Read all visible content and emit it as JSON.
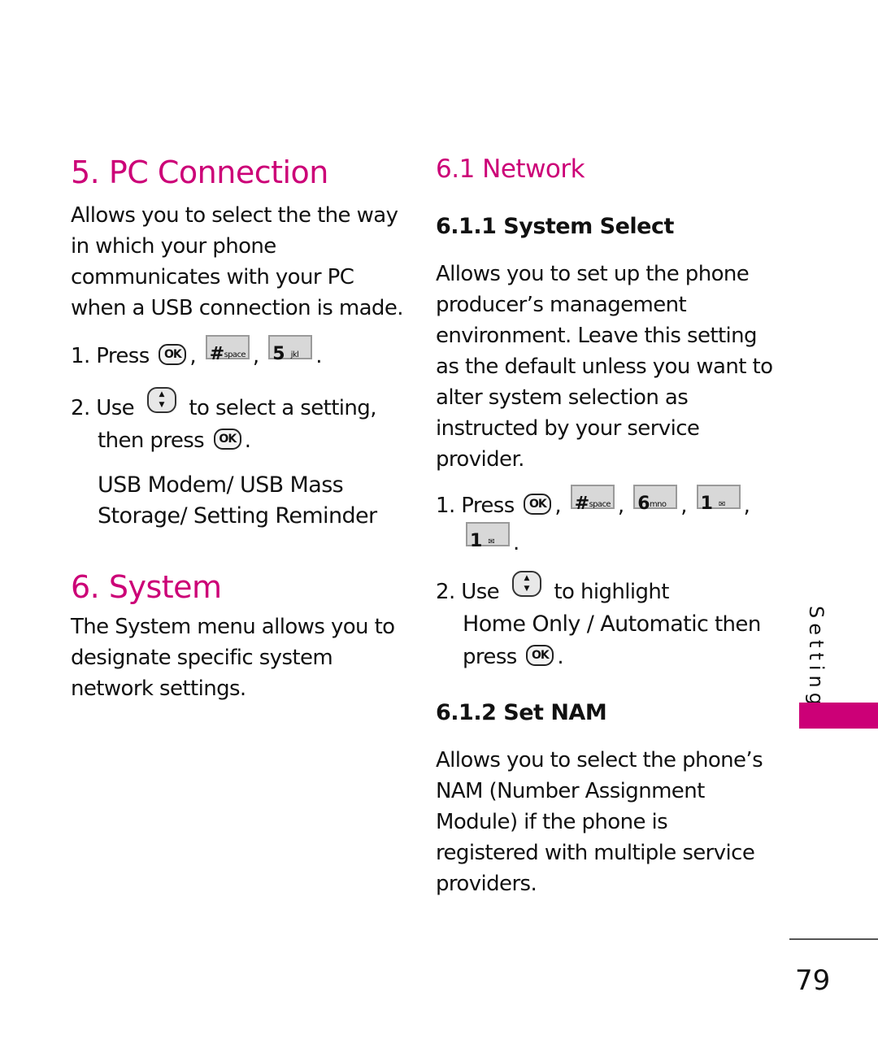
{
  "colors": {
    "accent": "#cc0077",
    "text": "#111111"
  },
  "left": {
    "pc_connection": {
      "title": "5. PC Connection",
      "description_lines": [
        "Allows you to select the the way",
        "in which your phone",
        "communicates with your PC",
        "when a USB connection is made."
      ],
      "step1": {
        "prefix": "1. Press",
        "keys": [
          "OK",
          "#",
          "5"
        ],
        "key_labels": {
          "hash_main": "#",
          "hash_sub": "space",
          "five_main": "5",
          "five_sub": "jkl"
        }
      },
      "step2": {
        "prefix": "2. Use",
        "middle": "to select a setting,",
        "line2": "then press",
        "end": "."
      },
      "options_lines": [
        "USB Modem/ USB Mass",
        "Storage/ Setting Reminder"
      ]
    },
    "system": {
      "title": "6. System",
      "description_lines": [
        "The System menu allows you to",
        "designate specific system",
        "network settings."
      ]
    }
  },
  "right": {
    "network": {
      "title": "6.1 Network"
    },
    "system_select": {
      "title": "6.1.1 System Select",
      "description_lines": [
        "Allows you to set up the phone",
        "producer’s management",
        "environment. Leave this setting",
        "as the default unless you want to",
        "alter system selection as",
        "instructed by your service",
        "provider."
      ],
      "step1": {
        "prefix": "1. Press",
        "key_labels": {
          "hash_main": "#",
          "hash_sub": "space",
          "six_main": "6",
          "six_sub": "mno",
          "one_main": "1",
          "one_sub": "✉"
        }
      },
      "step2": {
        "prefix": "2. Use",
        "middle": "to highlight",
        "bold_options": "Home Only / Automatic",
        "after": " then",
        "line3": "press",
        "end": "."
      }
    },
    "set_nam": {
      "title": "6.1.2 Set NAM",
      "description_lines": [
        "Allows you to select the phone’s",
        "NAM (Number Assignment",
        "Module) if the phone is",
        "registered with multiple service",
        "providers."
      ]
    }
  },
  "sidebar": {
    "section_label": "Settings"
  },
  "footer": {
    "page_number": "79"
  },
  "punct": {
    "comma": ",",
    "period": ".",
    "ok": "OK",
    "up": "▲",
    "down": "▼"
  }
}
